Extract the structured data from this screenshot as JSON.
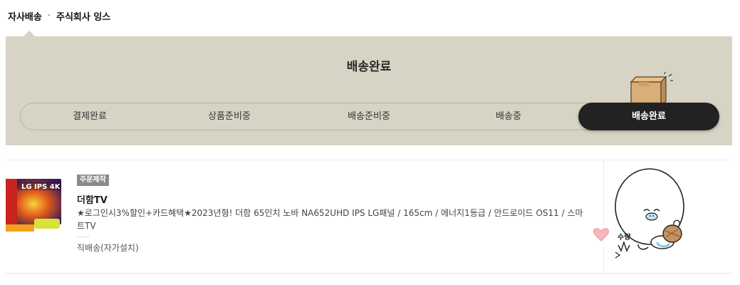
{
  "shipper": {
    "type": "자사배송",
    "separator": "·",
    "company": "주식회사 잉스"
  },
  "status": {
    "title": "배송완료",
    "steps": [
      {
        "label": "결제완료",
        "active": false
      },
      {
        "label": "상품준비중",
        "active": false
      },
      {
        "label": "배송준비중",
        "active": false
      },
      {
        "label": "배송중",
        "active": false
      },
      {
        "label": "배송완료",
        "active": true
      }
    ]
  },
  "product": {
    "badge": "주문제작",
    "name": "더함TV",
    "description": "★로그인시3%할인+카드혜택★2023년형! 더함 65인치 노바 NA652UHD IPS LG패널 / 165cm / 에너지1등급 / 안드로이드 OS11 / 스마트TV",
    "delivery": "직배송(자가설치)",
    "thumb_text": "LG IPS 4K"
  },
  "sticker": {
    "label": "수량"
  },
  "colors": {
    "panel": "#d8d4c5",
    "active_step": "#222222",
    "badge": "#8a8a8a"
  }
}
